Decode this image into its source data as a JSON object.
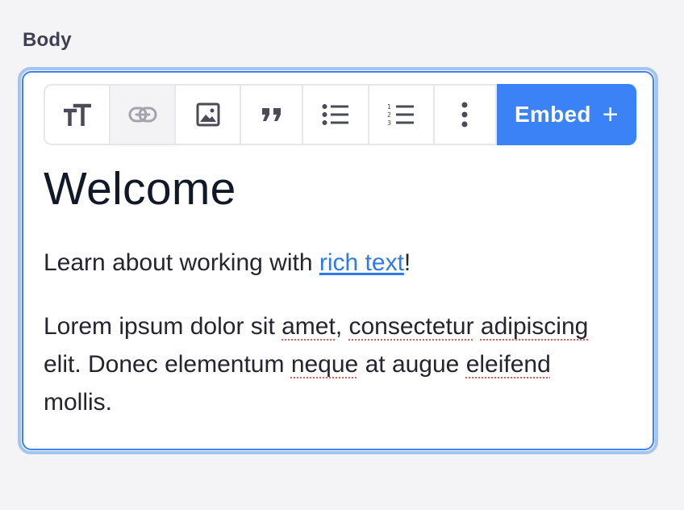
{
  "field": {
    "label": "Body"
  },
  "toolbar": {
    "buttons": [
      {
        "name": "text-size",
        "icon": "text-size-icon"
      },
      {
        "name": "link",
        "icon": "link-icon"
      },
      {
        "name": "image",
        "icon": "image-icon"
      },
      {
        "name": "quote",
        "icon": "quote-icon"
      },
      {
        "name": "bulleted-list",
        "icon": "bulleted-list-icon"
      },
      {
        "name": "numbered-list",
        "icon": "numbered-list-icon"
      },
      {
        "name": "more",
        "icon": "more-vertical-icon"
      }
    ],
    "embed_label": "Embed",
    "embed_icon": "+"
  },
  "content": {
    "heading": "Welcome",
    "para1": {
      "before": "Learn about working with ",
      "link": "rich text",
      "after": "!"
    },
    "para2": {
      "parts": [
        {
          "text": "Lorem ipsum dolor sit ",
          "misspelled": false
        },
        {
          "text": "amet",
          "misspelled": true
        },
        {
          "text": ", ",
          "misspelled": false
        },
        {
          "text": "consectetur",
          "misspelled": true
        },
        {
          "text": " ",
          "misspelled": false
        },
        {
          "text": "adipiscing",
          "misspelled": true
        },
        {
          "text": " elit. Donec elementum ",
          "misspelled": false
        },
        {
          "text": "neque",
          "misspelled": true
        },
        {
          "text": " at augue ",
          "misspelled": false
        },
        {
          "text": "eleifend",
          "misspelled": true
        },
        {
          "text": " mollis.",
          "misspelled": false
        }
      ]
    }
  },
  "colors": {
    "accent": "#3b82f6",
    "link": "#2f7ae8",
    "focus_ring": "#a5c5f1",
    "spellcheck": "#e35a5a"
  }
}
